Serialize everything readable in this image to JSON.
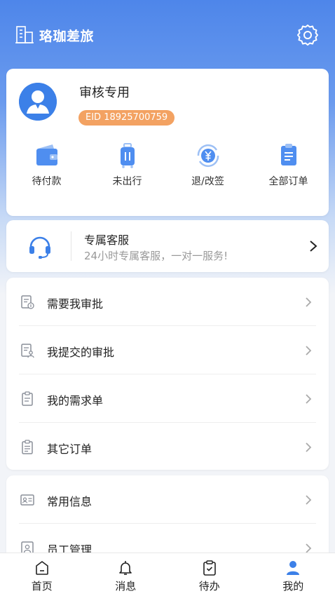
{
  "header": {
    "title": "珞珈差旅",
    "brand_icon": "building-icon",
    "settings_icon": "gear-icon"
  },
  "profile": {
    "name": "审核专用",
    "eid": "EID 18925700759",
    "avatar_icon": "user-avatar-icon"
  },
  "orders": [
    {
      "label": "待付款",
      "icon": "wallet-icon"
    },
    {
      "label": "未出行",
      "icon": "luggage-icon"
    },
    {
      "label": "退/改签",
      "icon": "yuan-refund-icon"
    },
    {
      "label": "全部订单",
      "icon": "clipboard-icon"
    }
  ],
  "service": {
    "title": "专属客服",
    "subtitle": "24小时专属客服，一对一服务!",
    "icon": "headset-icon"
  },
  "menu": [
    {
      "label": "需要我审批",
      "icon": "approval-doc-icon"
    },
    {
      "label": "我提交的审批",
      "icon": "submitted-doc-icon"
    },
    {
      "label": "我的需求单",
      "icon": "request-form-icon"
    },
    {
      "label": "其它订单",
      "icon": "other-orders-icon"
    }
  ],
  "menu2": [
    {
      "label": "常用信息",
      "icon": "id-card-icon"
    },
    {
      "label": "员工管理",
      "icon": "employee-icon"
    }
  ],
  "tabs": [
    {
      "label": "首页",
      "icon": "home-icon",
      "active": false
    },
    {
      "label": "消息",
      "icon": "bell-icon",
      "active": false
    },
    {
      "label": "待办",
      "icon": "todo-clipboard-icon",
      "active": false
    },
    {
      "label": "我的",
      "icon": "profile-icon",
      "active": true
    }
  ],
  "colors": {
    "primary": "#4e86ea",
    "accent_blue": "#3c80e8",
    "badge_orange": "#f3a262",
    "muted_text": "#999999",
    "icon_gray": "#8a8f99"
  }
}
